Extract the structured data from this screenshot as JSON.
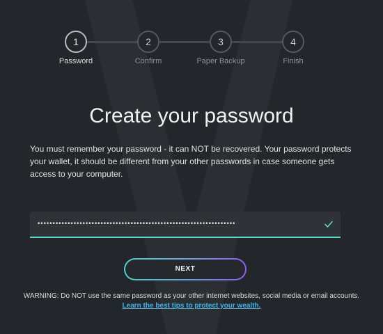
{
  "stepper": {
    "steps": [
      {
        "number": "1",
        "label": "Password",
        "active": true
      },
      {
        "number": "2",
        "label": "Confirm",
        "active": false
      },
      {
        "number": "3",
        "label": "Paper Backup",
        "active": false
      },
      {
        "number": "4",
        "label": "Finish",
        "active": false
      }
    ]
  },
  "main": {
    "title": "Create your password",
    "description": "You must remember your password - it can NOT be recovered. Your password protects your wallet, it should be different from your other passwords in case someone gets access to your computer.",
    "password_value": "••••••••••••••••••••••••••••••••••••••••••••••••••••••••••••••••••",
    "next_label": "NEXT",
    "warning_text": "WARNING: Do NOT use the same password as your other internet websites, social media or email accounts.",
    "tips_link": "Learn the best tips to protect your wealth."
  },
  "colors": {
    "background": "#23272b",
    "accent_teal": "#5ad7c8",
    "accent_purple": "#8f5cf0",
    "link_blue": "#3fb6e6"
  },
  "icons": {
    "field_status": "check-icon",
    "background_logo": "v-logo-watermark"
  }
}
